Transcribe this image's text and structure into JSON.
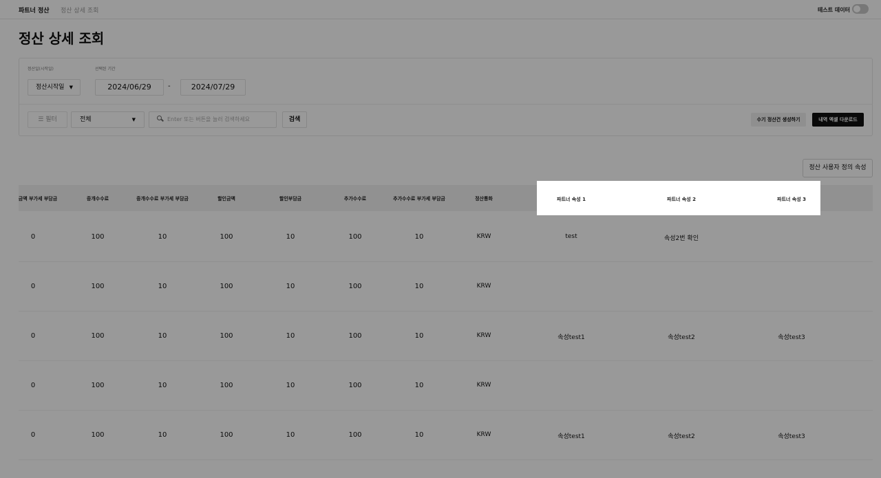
{
  "topbar": {
    "breadcrumb": [
      "파트너 정산",
      "정산 상세 조회"
    ],
    "test_data_label": "테스트 데이터",
    "test_data_enabled": false
  },
  "page_title": "정산 상세 조회",
  "filters": {
    "start_label": "정산일(시작일)",
    "range_label": "선택된 기간",
    "start_select_value": "정산시작일",
    "date_from": "2024/06/29",
    "date_separator": "-",
    "date_to": "2024/07/29",
    "filter_button": "필터",
    "scope_select_value": "전체",
    "search_placeholder": "Enter 또는 버튼을 눌러 검색하세요",
    "search_button": "검색",
    "manual_create_button": "수기 정산건 생성하기",
    "excel_download_button": "내역 엑셀 다운로드"
  },
  "custom_attr_button": "정산 사용자 정의 속성",
  "table": {
    "columns": [
      "금액 부가세 부담금",
      "중개수수료",
      "중개수수료 부가세 부담금",
      "할인금액",
      "할인부담금",
      "추가수수료",
      "추가수수료 부가세 부담금",
      "정산통화",
      "파트너 속성 1",
      "파트너 속성 2",
      "파트너 속성 3"
    ],
    "rows": [
      [
        "0",
        "100",
        "10",
        "100",
        "10",
        "100",
        "10",
        "KRW",
        "test",
        "속성2번 확인",
        ""
      ],
      [
        "0",
        "100",
        "10",
        "100",
        "10",
        "100",
        "10",
        "KRW",
        "",
        "",
        ""
      ],
      [
        "0",
        "100",
        "10",
        "100",
        "10",
        "100",
        "10",
        "KRW",
        "속성test1",
        "속성test2",
        "속성test3"
      ],
      [
        "0",
        "100",
        "10",
        "100",
        "10",
        "100",
        "10",
        "KRW",
        "",
        "",
        ""
      ],
      [
        "0",
        "100",
        "10",
        "100",
        "10",
        "100",
        "10",
        "KRW",
        "속성test1",
        "속성test2",
        "속성test3"
      ]
    ]
  },
  "colors": {
    "accent_button": "#111111",
    "overlay": "#000000"
  }
}
